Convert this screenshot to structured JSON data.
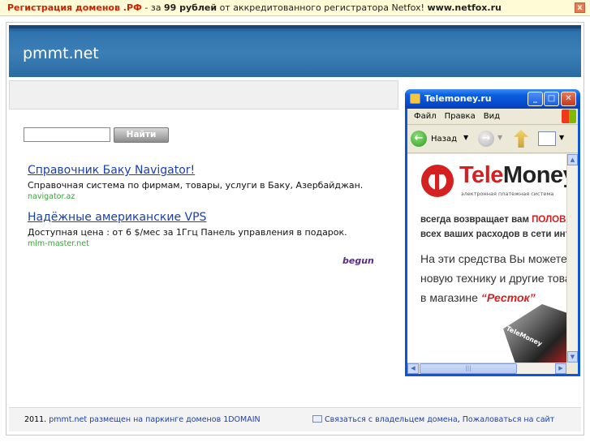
{
  "topbar": {
    "part1": "Регистрация доменов .РФ",
    "part2": " - за ",
    "part3": "99 рублей",
    "part4": " от аккредитованного регистратора Netfox! ",
    "part5": "www.netfox.ru",
    "close_label": "x"
  },
  "header": {
    "title": "pmmt.net"
  },
  "search": {
    "value": "",
    "button_label": "Найти"
  },
  "ads": [
    {
      "title": "Справочник Баку Navigator!",
      "desc": "Справочная система по фирмам, товары, услуги в Баку, Азербайджан.",
      "url": "navigator.az"
    },
    {
      "title": "Надёжные американские VPS",
      "desc": "Доступная цена : от 6 $/мес за 1Ггц Панель управления в подарок.",
      "url": "mlm-master.net"
    }
  ],
  "ad_network": "begun",
  "footer": {
    "year": "2011.",
    "parking_text": "pmmt.net размещен на паркинге доменов 1DOMAIN",
    "contact": "Связаться с владельцем домена",
    "complain": "Пожаловаться на сайт"
  },
  "popup": {
    "title": "Telemoney.ru",
    "menu": [
      "Файл",
      "Правка",
      "Вид"
    ],
    "back_label": "Назад",
    "banner": {
      "brand_a": "Tele",
      "brand_b": "Money",
      "tagline": "электронная платежная система",
      "line1a": "всегда возвращает вам ",
      "line1b": "ПОЛОВИН",
      "line2": "всех ваших расходов в сети интер",
      "line3": "На эти средства Вы можете п",
      "line4": "новую технику и другие това",
      "line5a": "в магазине ",
      "line5b": "“Ресток”",
      "product_label": "TeleMoney"
    }
  },
  "colors": {
    "header": "#2f72ad",
    "link": "#1a3fb0",
    "url": "#3aa33a",
    "brand_red": "#d42020"
  }
}
